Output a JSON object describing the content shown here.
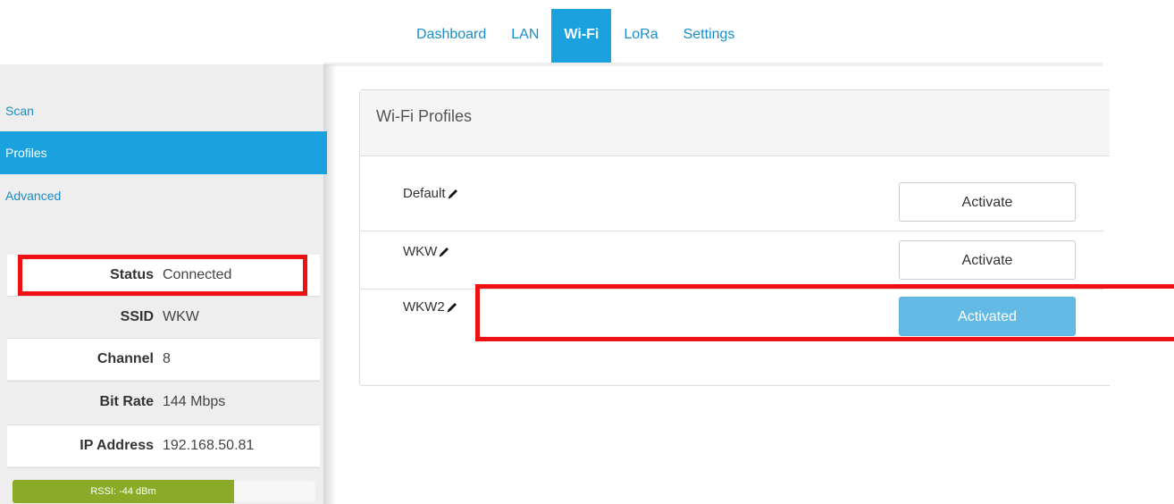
{
  "nav": {
    "tabs": [
      {
        "label": "Dashboard"
      },
      {
        "label": "LAN"
      },
      {
        "label": "Wi-Fi"
      },
      {
        "label": "LoRa"
      },
      {
        "label": "Settings"
      }
    ]
  },
  "sidebar": {
    "items": [
      {
        "label": "Scan"
      },
      {
        "label": "Profiles"
      },
      {
        "label": "Advanced"
      }
    ],
    "status": [
      {
        "label": "Status",
        "value": "Connected"
      },
      {
        "label": "SSID",
        "value": "WKW"
      },
      {
        "label": "Channel",
        "value": "8"
      },
      {
        "label": "Bit Rate",
        "value": "144 Mbps"
      },
      {
        "label": "IP Address",
        "value": "192.168.50.81"
      }
    ],
    "rssi": {
      "text": "RSSI: -44 dBm",
      "level_percent": 73
    }
  },
  "panel": {
    "title": "Wi-Fi Profiles",
    "profiles": [
      {
        "name": "Default",
        "button": "Activate"
      },
      {
        "name": "WKW",
        "button": "Activate"
      },
      {
        "name": "WKW2",
        "button": "Activated"
      }
    ]
  },
  "colors": {
    "accent": "#1ba1de",
    "activated_button": "#63bbe5",
    "rssi_bar": "#8aab27",
    "highlight": "#ee1111"
  },
  "icons": {
    "edit": "pencil-icon"
  }
}
